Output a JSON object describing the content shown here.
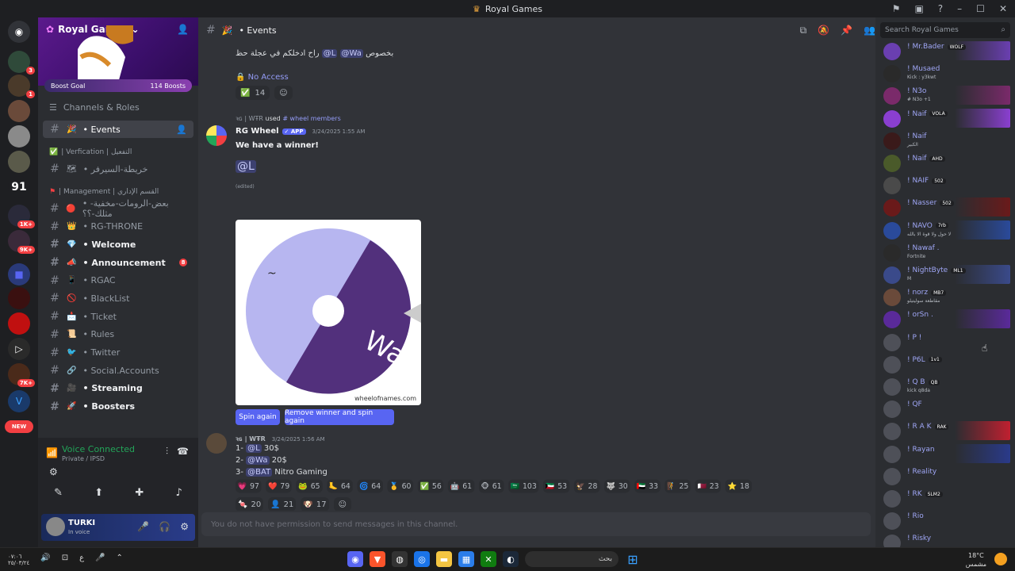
{
  "titlebar": {
    "title": "Royal Games"
  },
  "guilds": {
    "badges": [
      "3",
      "1",
      "1K+",
      "9K+",
      "7K+"
    ],
    "server_91": "91",
    "new_label": "NEW"
  },
  "sidebar": {
    "server_name": "Royal Games",
    "boost_goal": "Boost Goal",
    "boost_count": "114 Boosts",
    "channels_roles": "Channels & Roles",
    "active_channel": "• Events",
    "cat_verification": "| Verfication | التفعيل",
    "verification_channel": "• خريطة-السيرفر",
    "cat_management": "| Management | القسم الإداري",
    "items": [
      {
        "label": "• بعض-الرومات-مخفية-مثلك-؟؟",
        "emoji": "🔴",
        "bold": false
      },
      {
        "label": "• RG-THRONE",
        "emoji": "👑",
        "bold": false
      },
      {
        "label": "• Welcome",
        "emoji": "💎",
        "bold": true
      },
      {
        "label": "• Announcement",
        "emoji": "📣",
        "bold": true,
        "badge": "8"
      },
      {
        "label": "• RGAC",
        "emoji": "📱",
        "bold": false
      },
      {
        "label": "• BlackList",
        "emoji": "🚫",
        "bold": false
      },
      {
        "label": "• Ticket",
        "emoji": "📩",
        "bold": false
      },
      {
        "label": "• Rules",
        "emoji": "📜",
        "bold": false
      },
      {
        "label": "• Twitter",
        "emoji": "🐦",
        "bold": false
      },
      {
        "label": "• Social.Accounts",
        "emoji": "🔗",
        "bold": false
      },
      {
        "label": "• Streaming",
        "emoji": "🎥",
        "bold": true
      },
      {
        "label": "• Boosters",
        "emoji": "🚀",
        "bold": true
      }
    ],
    "voice_connected": "Voice Connected",
    "voice_channel": "Private / IPSD",
    "user_name": "TURKI",
    "user_status": "In voice"
  },
  "channel": {
    "name": "• Events",
    "search_placeholder": "Search Royal Games",
    "composer_placeholder": "You do not have permission to send messages in this channel."
  },
  "messages": {
    "first": {
      "text_rtl": "بخصوص",
      "mention1": "@Wa",
      "mention2": "@L",
      "text_after": "راح ادخلكم في عجلة حظ",
      "no_access": "No Access",
      "reaction_count": "14"
    },
    "wheel": {
      "reply_user": "ꝛɢ | WŦR",
      "reply_used": "used",
      "reply_command": "# wheel members",
      "author": "RG Wheel",
      "app_tag": "✓ APP",
      "timestamp": "3/24/2025 1:55 AM",
      "headline": "We have a winner!",
      "winner": "@L",
      "edited": "(edited)",
      "wheel_label": "Wa",
      "watermark": "wheelofnames.com",
      "btn_spin": "Spin again",
      "btn_remove": "Remove winner and spin again"
    },
    "prizes": {
      "author": "ꝛɢ | WŦR",
      "timestamp": "3/24/2025 1:56 AM",
      "line1_prefix": "1- ",
      "line1_mention": "@L",
      "line1_amount": " 30$",
      "line2_prefix": "2- ",
      "line2_mention": "@Wa",
      "line2_amount": " 20$",
      "line3_prefix": "3- ",
      "line3_mention": "@BAT",
      "line3_amount": " Nitro Gaming",
      "reactions": [
        {
          "e": "💗",
          "n": "97"
        },
        {
          "e": "❤️",
          "n": "79"
        },
        {
          "e": "🐸",
          "n": "65"
        },
        {
          "e": "🦶",
          "n": "64"
        },
        {
          "e": "🌀",
          "n": "64"
        },
        {
          "e": "🥇",
          "n": "60"
        },
        {
          "e": "✅",
          "n": "56"
        },
        {
          "e": "🤖",
          "n": "61"
        },
        {
          "e": "🐵",
          "n": "61"
        },
        {
          "e": "🇸🇦",
          "n": "103"
        },
        {
          "e": "🇰🇼",
          "n": "53"
        },
        {
          "e": "🦅",
          "n": "28"
        },
        {
          "e": "🐺",
          "n": "30"
        },
        {
          "e": "🇦🇪",
          "n": "33"
        },
        {
          "e": "🧗",
          "n": "25"
        },
        {
          "e": "🇶🇦",
          "n": "23"
        },
        {
          "e": "⭐",
          "n": "18"
        },
        {
          "e": "🍬",
          "n": "20"
        },
        {
          "e": "👤",
          "n": "21"
        },
        {
          "e": "🐶",
          "n": "17"
        }
      ]
    }
  },
  "members": [
    {
      "name": "! Mr.Bader",
      "tag": "WOLF",
      "status": ""
    },
    {
      "name": "! Musaed",
      "tag": "",
      "status": "Kick : y3kwt"
    },
    {
      "name": "! N3o",
      "tag": "",
      "status": "# N3o +1"
    },
    {
      "name": "! Naif",
      "tag": "VOLA",
      "status": ""
    },
    {
      "name": "! Naif",
      "tag": "",
      "status": "الكبير"
    },
    {
      "name": "! Naif",
      "tag": "AHD",
      "status": ""
    },
    {
      "name": "! NAIF",
      "tag": "502",
      "status": ""
    },
    {
      "name": "! Nasser",
      "tag": "502",
      "status": ""
    },
    {
      "name": "! NAVO",
      "tag": "7rb",
      "status": "لا حول ولا قوة الا بالله"
    },
    {
      "name": "! Nawaf .",
      "tag": "",
      "status": "Fortnite"
    },
    {
      "name": "! NightByte",
      "tag": "ML1",
      "status": "M"
    },
    {
      "name": "! norz",
      "tag": "MB7",
      "status": "مقاطعة سوليتيلو"
    },
    {
      "name": "! orSn .",
      "tag": "",
      "status": ""
    },
    {
      "name": "! P !",
      "tag": "",
      "status": ""
    },
    {
      "name": "! P6L",
      "tag": "1v1",
      "status": ""
    },
    {
      "name": "! Q B",
      "tag": "QB",
      "status": "kick q8da"
    },
    {
      "name": "! QF",
      "tag": "",
      "status": ""
    },
    {
      "name": "! R A K",
      "tag": "RAK",
      "status": ""
    },
    {
      "name": "! Rayan",
      "tag": "",
      "status": ""
    },
    {
      "name": "! Reality",
      "tag": "",
      "status": ""
    },
    {
      "name": "! RK",
      "tag": "SLM2",
      "status": ""
    },
    {
      "name": "! Rio",
      "tag": "",
      "status": ""
    },
    {
      "name": "! Risky",
      "tag": "",
      "status": ""
    }
  ],
  "taskbar": {
    "time": "٠٧:٠٦",
    "date": "٢٥/٠٣/٢٤",
    "lang": "ع",
    "search": "بحث",
    "weather_temp": "18°C",
    "weather_desc": "مشمس"
  },
  "colors": {
    "accent": "#5865f2",
    "online": "#23a559",
    "danger": "#f23f42"
  }
}
